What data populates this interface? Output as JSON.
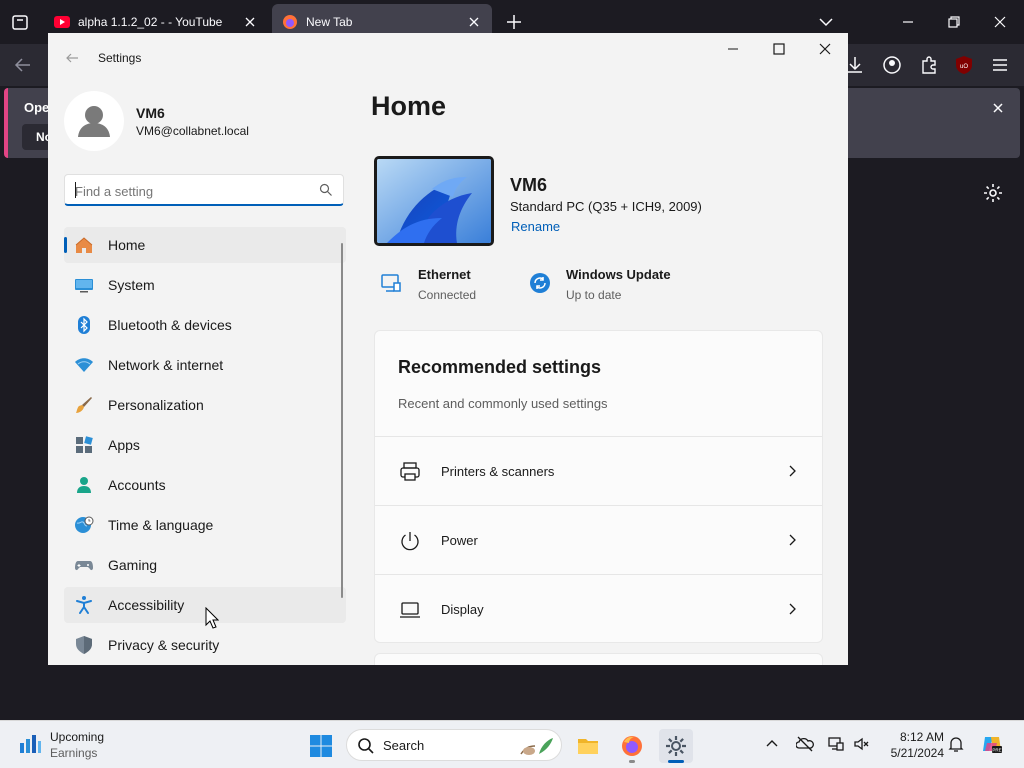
{
  "browser": {
    "tabs": [
      {
        "label": "alpha 1.1.2_02 - - YouTube",
        "active": false
      },
      {
        "label": "New Tab",
        "active": true
      }
    ],
    "notice": {
      "text": "Oper",
      "button": "No"
    }
  },
  "settings": {
    "window_title": "Settings",
    "profile": {
      "name": "VM6",
      "email": "VM6@collabnet.local"
    },
    "search": {
      "placeholder": "Find a setting"
    },
    "nav": [
      {
        "label": "Home",
        "icon": "home-icon",
        "state": "selected"
      },
      {
        "label": "System",
        "icon": "system-icon"
      },
      {
        "label": "Bluetooth & devices",
        "icon": "bluetooth-icon"
      },
      {
        "label": "Network & internet",
        "icon": "wifi-icon"
      },
      {
        "label": "Personalization",
        "icon": "brush-icon"
      },
      {
        "label": "Apps",
        "icon": "apps-icon"
      },
      {
        "label": "Accounts",
        "icon": "person-icon"
      },
      {
        "label": "Time & language",
        "icon": "globe-clock-icon"
      },
      {
        "label": "Gaming",
        "icon": "gamepad-icon"
      },
      {
        "label": "Accessibility",
        "icon": "accessibility-icon",
        "state": "hover"
      },
      {
        "label": "Privacy & security",
        "icon": "shield-icon"
      }
    ],
    "main": {
      "title": "Home",
      "device": {
        "name": "VM6",
        "spec": "Standard PC (Q35 + ICH9, 2009)",
        "rename": "Rename"
      },
      "status": [
        {
          "title": "Ethernet",
          "sub": "Connected",
          "icon": "ethernet-icon"
        },
        {
          "title": "Windows Update",
          "sub": "Up to date",
          "icon": "windows-update-icon"
        }
      ],
      "recommended": {
        "title": "Recommended settings",
        "subtitle": "Recent and commonly used settings",
        "items": [
          {
            "label": "Printers & scanners",
            "icon": "printer-icon"
          },
          {
            "label": "Power",
            "icon": "power-icon"
          },
          {
            "label": "Display",
            "icon": "display-icon"
          }
        ]
      }
    }
  },
  "taskbar": {
    "widget": {
      "title": "Upcoming",
      "subtitle": "Earnings"
    },
    "search_label": "Search",
    "time": "8:12 AM",
    "date": "5/21/2024"
  },
  "colors": {
    "accent": "#005fb8",
    "browser_bg": "#1c1b22",
    "settings_bg": "#f3f3f3"
  }
}
